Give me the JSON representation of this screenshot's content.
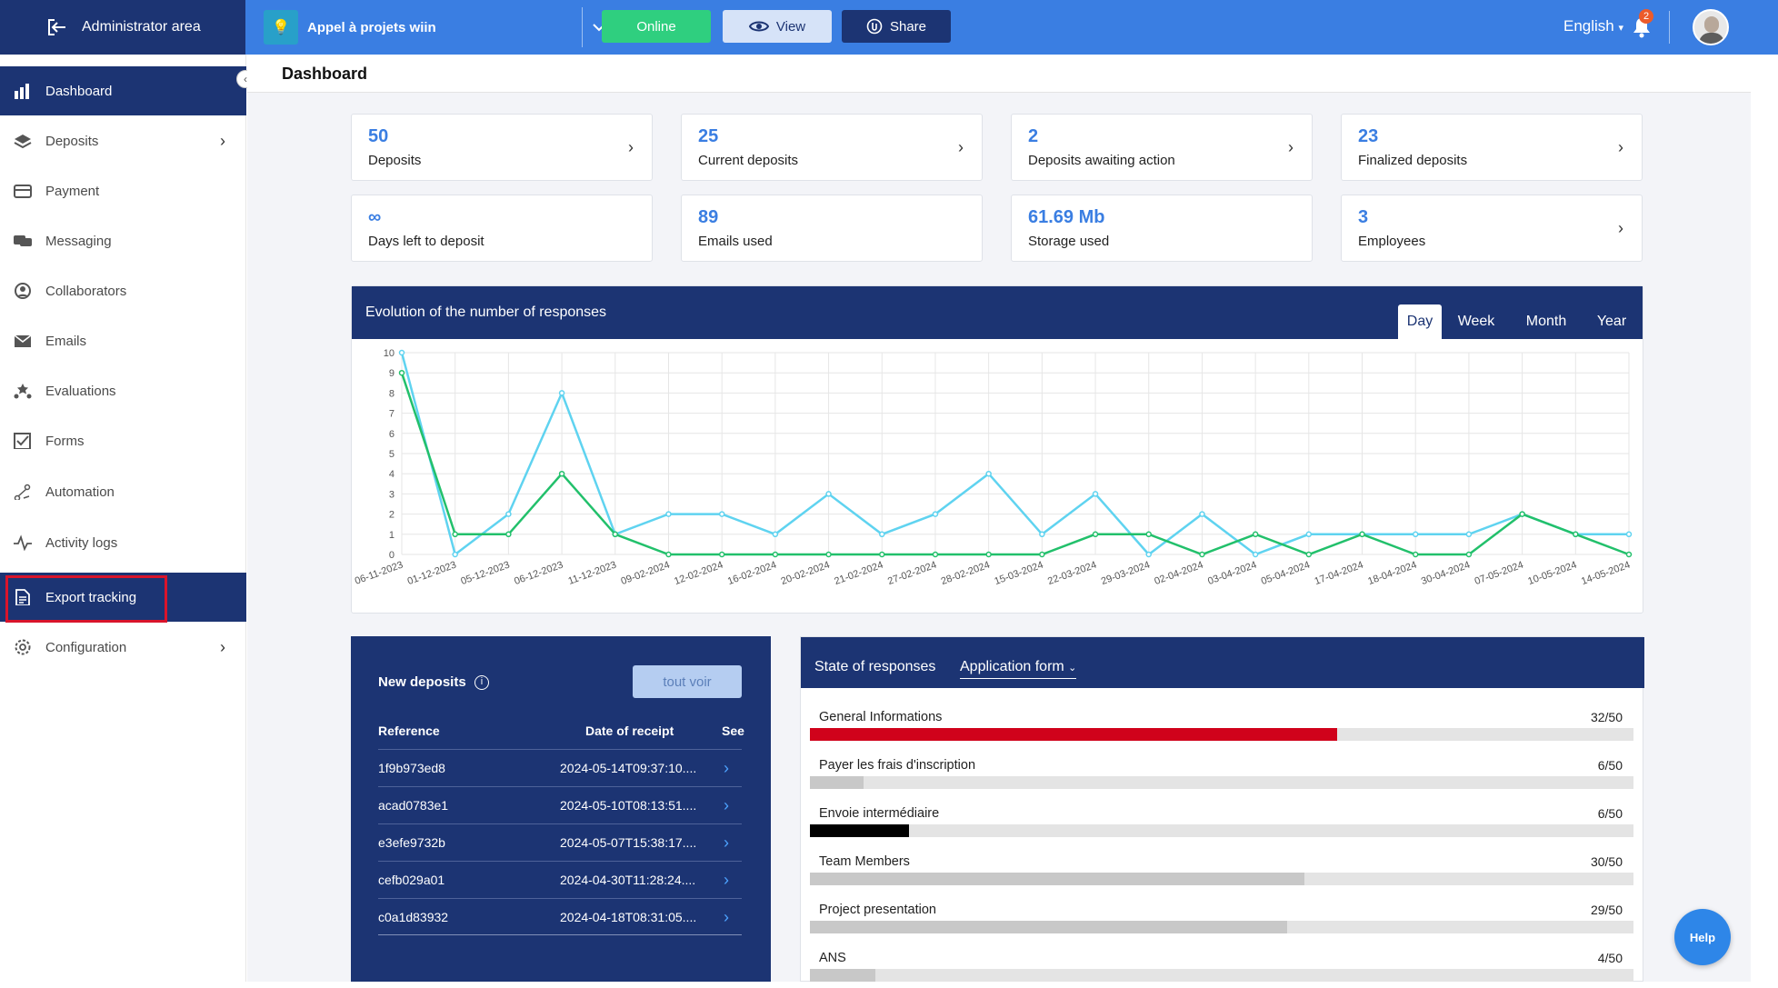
{
  "topbar": {
    "admin_label": "Administrator area",
    "project_name": "Appel à projets wiin",
    "online_label": "Online",
    "view_label": "View",
    "share_label": "Share",
    "language": "English",
    "notification_count": "2"
  },
  "sidebar": {
    "items": [
      {
        "label": "Dashboard",
        "icon": "bar-chart-icon"
      },
      {
        "label": "Deposits",
        "icon": "layers-icon"
      },
      {
        "label": "Payment",
        "icon": "credit-card-icon"
      },
      {
        "label": "Messaging",
        "icon": "chat-icon"
      },
      {
        "label": "Collaborators",
        "icon": "user-circle-icon"
      },
      {
        "label": "Emails",
        "icon": "envelope-icon"
      },
      {
        "label": "Evaluations",
        "icon": "stars-icon"
      },
      {
        "label": "Forms",
        "icon": "checkbox-icon"
      },
      {
        "label": "Automation",
        "icon": "automation-icon"
      },
      {
        "label": "Activity logs",
        "icon": "pulse-icon"
      },
      {
        "label": "Export tracking",
        "icon": "document-icon"
      },
      {
        "label": "Configuration",
        "icon": "gear-icon"
      }
    ]
  },
  "page": {
    "title": "Dashboard"
  },
  "cards": [
    {
      "value": "50",
      "label": "Deposits"
    },
    {
      "value": "25",
      "label": "Current deposits"
    },
    {
      "value": "2",
      "label": "Deposits awaiting action"
    },
    {
      "value": "23",
      "label": "Finalized deposits"
    },
    {
      "value": "∞",
      "label": "Days left to deposit"
    },
    {
      "value": "89",
      "label": "Emails used"
    },
    {
      "value": "61.69 Mb",
      "label": "Storage used"
    },
    {
      "value": "3",
      "label": "Employees"
    }
  ],
  "chart_panel": {
    "title": "Evolution of the number of responses",
    "tabs": [
      "Day",
      "Week",
      "Month",
      "Year"
    ],
    "selected_tab": "Day"
  },
  "chart_data": {
    "type": "line",
    "categories": [
      "06-11-2023",
      "01-12-2023",
      "05-12-2023",
      "06-12-2023",
      "11-12-2023",
      "09-02-2024",
      "12-02-2024",
      "16-02-2024",
      "20-02-2024",
      "21-02-2024",
      "27-02-2024",
      "28-02-2024",
      "15-03-2024",
      "22-03-2024",
      "29-03-2024",
      "02-04-2024",
      "03-04-2024",
      "05-04-2024",
      "17-04-2024",
      "18-04-2024",
      "30-04-2024",
      "07-05-2024",
      "10-05-2024",
      "14-05-2024"
    ],
    "series": [
      {
        "color": "#5fd3f0",
        "values": [
          10,
          0,
          2,
          8,
          1,
          2,
          2,
          1,
          3,
          1,
          2,
          4,
          1,
          3,
          0,
          2,
          0,
          1,
          1,
          1,
          1,
          2,
          1,
          1
        ]
      },
      {
        "color": "#22c06b",
        "values": [
          9,
          1,
          1,
          4,
          1,
          0,
          0,
          0,
          0,
          0,
          0,
          0,
          0,
          1,
          1,
          0,
          1,
          0,
          1,
          0,
          0,
          2,
          1,
          0
        ]
      }
    ],
    "ylim": [
      0,
      10
    ],
    "yticks": [
      0,
      1,
      2,
      3,
      4,
      5,
      6,
      7,
      8,
      9,
      10
    ],
    "grid": true
  },
  "deposits_panel": {
    "title": "New deposits",
    "see_all_label": "tout voir",
    "headers": {
      "reference": "Reference",
      "date": "Date of receipt",
      "see": "See"
    },
    "rows": [
      {
        "reference": "1f9b973ed8",
        "date": "2024-05-14T09:37:10...."
      },
      {
        "reference": "acad0783e1",
        "date": "2024-05-10T08:13:51...."
      },
      {
        "reference": "e3efe9732b",
        "date": "2024-05-07T15:38:17...."
      },
      {
        "reference": "cefb029a01",
        "date": "2024-04-30T11:28:24...."
      },
      {
        "reference": "c0a1d83932",
        "date": "2024-04-18T08:31:05...."
      }
    ]
  },
  "state_panel": {
    "title": "State of responses",
    "selector": "Application form",
    "rows": [
      {
        "name": "General Informations",
        "value": "32/50",
        "fraction": 0.64,
        "color": "#d0021b"
      },
      {
        "name": "Payer les frais d'inscription",
        "value": "6/50",
        "fraction": 0.065,
        "color": "#c8c8c8"
      },
      {
        "name": "Envoie intermédiaire",
        "value": "6/50",
        "fraction": 0.12,
        "color": "#000000"
      },
      {
        "name": "Team Members",
        "value": "30/50",
        "fraction": 0.6,
        "color": "#c8c8c8"
      },
      {
        "name": "Project presentation",
        "value": "29/50",
        "fraction": 0.58,
        "color": "#c8c8c8"
      },
      {
        "name": "ANS",
        "value": "4/50",
        "fraction": 0.08,
        "color": "#c8c8c8"
      }
    ]
  },
  "help_label": "Help"
}
